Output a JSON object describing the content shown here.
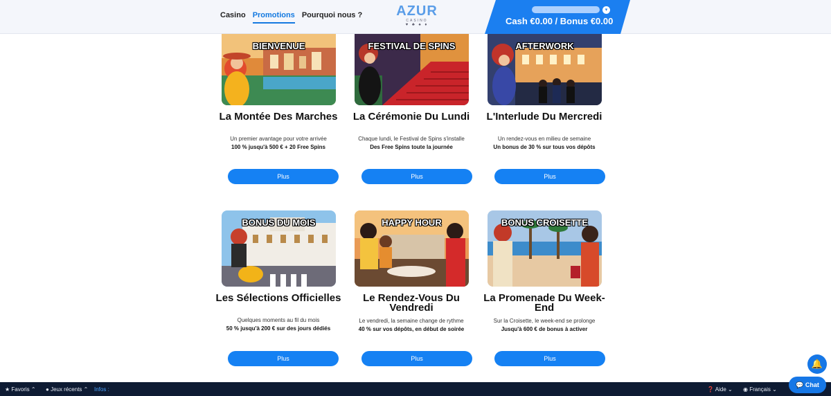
{
  "header": {
    "nav": [
      "Casino",
      "Promotions",
      "Pourquoi nous ?"
    ],
    "active_nav": "Promotions",
    "logo": {
      "main": "AZUR",
      "sub": "CASINO",
      "dots": "♥ ♣ ♠ ♦"
    },
    "balance": "Cash €0.00 / Bonus €0.00",
    "colors": {
      "accent": "#1581f3",
      "panel": "#1b7ff0",
      "footer": "#0e1b33"
    }
  },
  "promotions": [
    {
      "banner": "BIENVENUE",
      "title": "La Montée Des Marches",
      "subtitle": "Un premier avantage pour votre arrivée",
      "offer": "100 % jusqu'à 500 € + 20 Free Spins",
      "button": "Plus"
    },
    {
      "banner": "FESTIVAL DE SPINS",
      "title": "La Cérémonie Du Lundi",
      "subtitle": "Chaque lundi, le Festival de Spins s'installe",
      "offer": "Des Free Spins toute la journée",
      "button": "Plus"
    },
    {
      "banner": "AFTERWORK",
      "title": "L'Interlude Du Mercredi",
      "subtitle": "Un rendez-vous en milieu de semaine",
      "offer": "Un bonus de 30 % sur tous vos dépôts",
      "button": "Plus"
    },
    {
      "banner": "BONUS DU MOIS",
      "title": "Les Sélections Officielles",
      "subtitle": "Quelques moments au fil du mois",
      "offer": "50 % jusqu'à 200 € sur des jours dédiés",
      "button": "Plus"
    },
    {
      "banner": "HAPPY HOUR",
      "title": "Le Rendez-Vous Du Vendredi",
      "subtitle": "Le vendredi, la semaine change de rythme",
      "offer": "40 % sur vos dépôts, en début de soirée",
      "button": "Plus"
    },
    {
      "banner": "BONUS CROISETTE",
      "title": "La Promenade Du Week-End",
      "subtitle": "Sur la Croisette, le week-end se prolonge",
      "offer": "Jusqu'à 600 € de bonus à activer",
      "button": "Plus"
    }
  ],
  "footer": {
    "favoris": "Favoris",
    "recents": "Jeux récents",
    "infos": "Infos :",
    "aide": "Aide",
    "langue": "Français",
    "chat": "Chat"
  }
}
